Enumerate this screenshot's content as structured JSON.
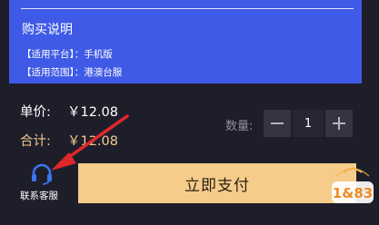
{
  "purchase_info": {
    "title": "购买说明",
    "lines": [
      "【适用平台】：手机版",
      "【适用范围】：港澳台服"
    ]
  },
  "order": {
    "unit_price_label": "单价:",
    "unit_price_value": "￥12.08",
    "total_label": "合计:",
    "total_value": "￥12.08"
  },
  "quantity": {
    "label": "数量:",
    "value": "1"
  },
  "support": {
    "label": "联系客服"
  },
  "pay_button": {
    "label": "立即支付"
  },
  "watermark": {
    "text": "1&83"
  },
  "colors": {
    "background": "#1e1e2b",
    "info_panel": "#3f5ae6",
    "pay_button": "#f6cc8b",
    "total_text": "#f2c98a",
    "support_icon": "#3b76ee",
    "annotation_arrow": "#e0282a"
  }
}
